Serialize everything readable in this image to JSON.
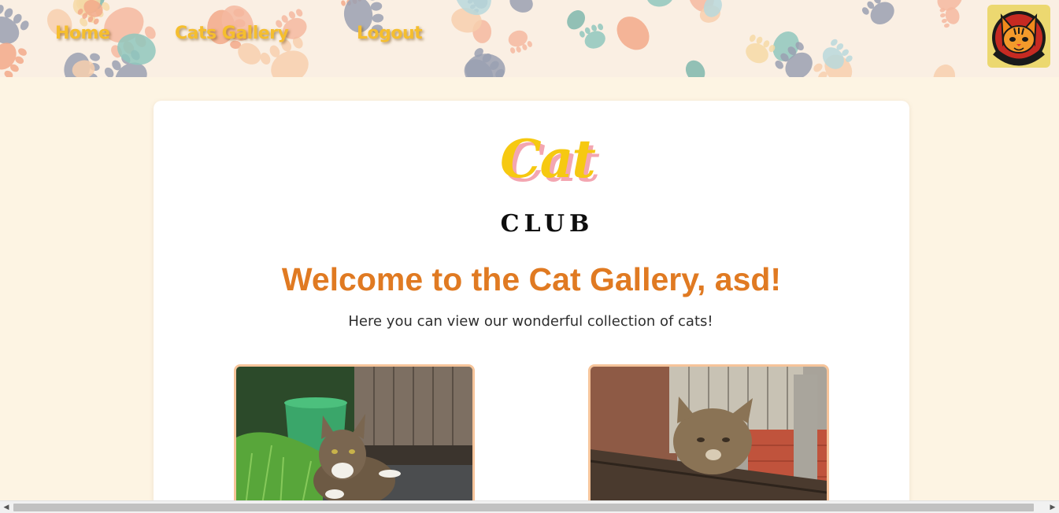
{
  "nav": {
    "home_label": "Home",
    "gallery_label": "Cats Gallery",
    "logout_label": "Logout"
  },
  "badge": {
    "text": "ORANGE CAT",
    "icon": "orange-cat-logo"
  },
  "logo": {
    "word_top": "Cat",
    "word_bottom": "CLUB"
  },
  "main": {
    "welcome": "Welcome to the Cat Gallery, asd!",
    "subtitle": "Here you can view our wonderful collection of cats!"
  },
  "gallery": {
    "photos": [
      {
        "subject": "tabby cat lying on grass beside a wooden shed"
      },
      {
        "subject": "tabby cat resting on a wooden bench by a brick wall"
      }
    ]
  },
  "colors": {
    "page_bg": "#fdf4e3",
    "nav_text": "#f5be2e",
    "welcome_text": "#e07a22",
    "logo_yellow": "#f6c911",
    "logo_pink": "#f3a6b1",
    "photo_border": "#f6c49a"
  },
  "scrollbar": {
    "position_fraction": 0.0
  }
}
